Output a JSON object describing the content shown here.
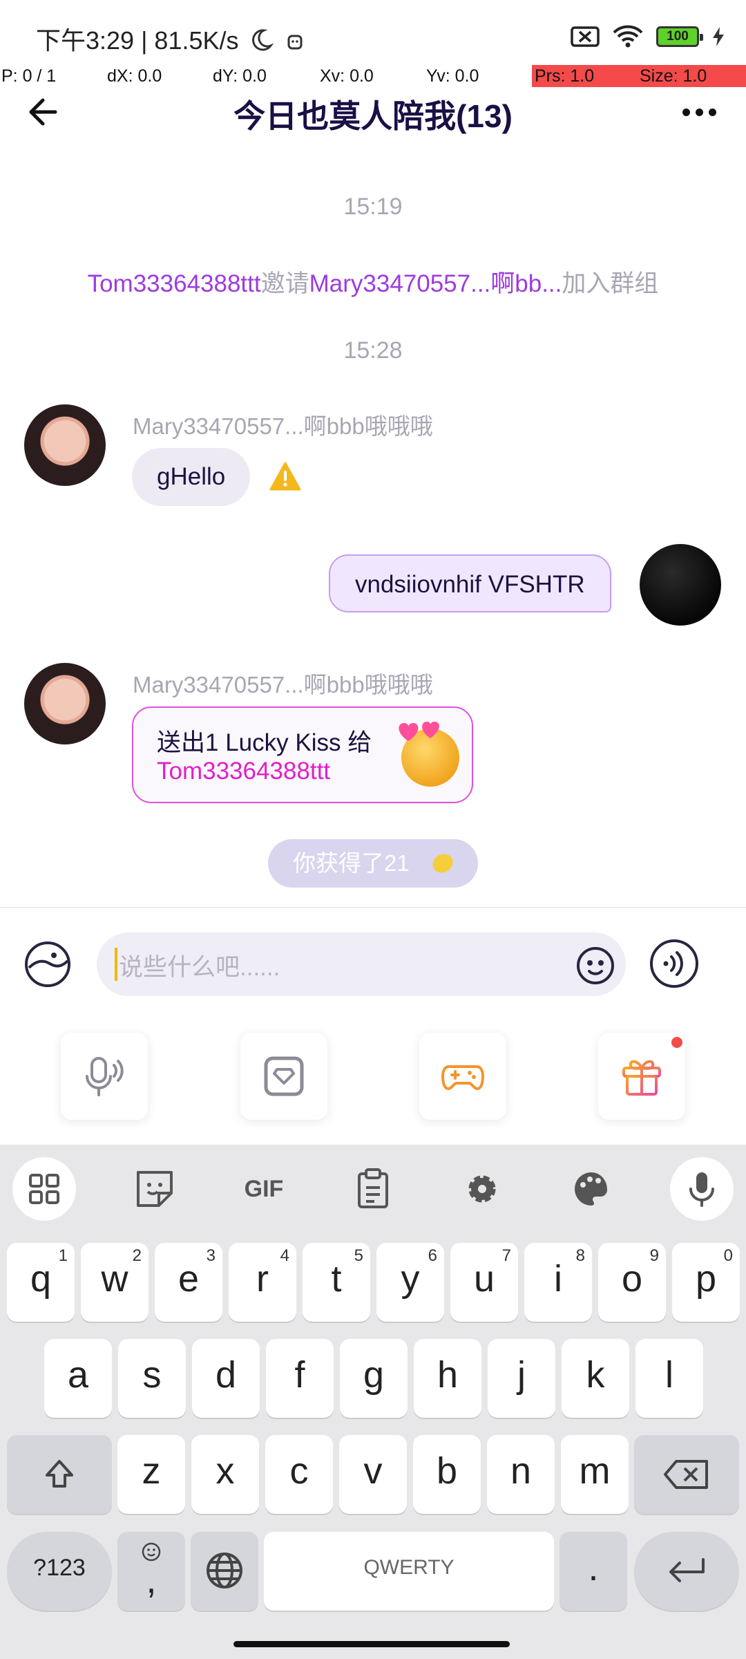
{
  "status_bar": {
    "time_speed": "下午3:29 | 81.5K/s",
    "battery": "100"
  },
  "debug_bar": {
    "p": "P: 0 / 1",
    "dx": "dX: 0.0",
    "dy": "dY: 0.0",
    "xv": "Xv: 0.0",
    "yv": "Yv: 0.0",
    "prs": "Prs: 1.0",
    "size": "Size: 1.0"
  },
  "header": {
    "title": "今日也莫人陪我(13)"
  },
  "chat": {
    "timestamp1": "15:19",
    "system": {
      "inviter": "Tom33364388ttt",
      "verb": "邀请",
      "invitee": "Mary33470557...啊bb...",
      "suffix": "加入群组"
    },
    "timestamp2": "15:28",
    "msg1": {
      "sender": "Mary33470557...啊bbb哦哦哦",
      "text": "gHello"
    },
    "msg2": {
      "text": "vndsiiovnhif VFSHTR"
    },
    "msg3": {
      "sender": "Mary33470557...啊bbb哦哦哦",
      "gift_line1": "送出1 Lucky Kiss 给",
      "gift_line2": "Tom33364388ttt"
    },
    "reward": "你获得了21"
  },
  "input_bar": {
    "placeholder": "说些什么吧......"
  },
  "keyboard": {
    "row1": [
      {
        "k": "q",
        "n": "1"
      },
      {
        "k": "w",
        "n": "2"
      },
      {
        "k": "e",
        "n": "3"
      },
      {
        "k": "r",
        "n": "4"
      },
      {
        "k": "t",
        "n": "5"
      },
      {
        "k": "y",
        "n": "6"
      },
      {
        "k": "u",
        "n": "7"
      },
      {
        "k": "i",
        "n": "8"
      },
      {
        "k": "o",
        "n": "9"
      },
      {
        "k": "p",
        "n": "0"
      }
    ],
    "row2": [
      "a",
      "s",
      "d",
      "f",
      "g",
      "h",
      "j",
      "k",
      "l"
    ],
    "row3": [
      "z",
      "x",
      "c",
      "v",
      "b",
      "n",
      "m"
    ],
    "symbols": "?123",
    "comma": ",",
    "space": "QWERTY",
    "period": ".",
    "gif": "GIF"
  },
  "colors": {
    "accent_purple": "#9c3be0",
    "gift_pink": "#e11fc9",
    "title_navy": "#1b0f45"
  }
}
